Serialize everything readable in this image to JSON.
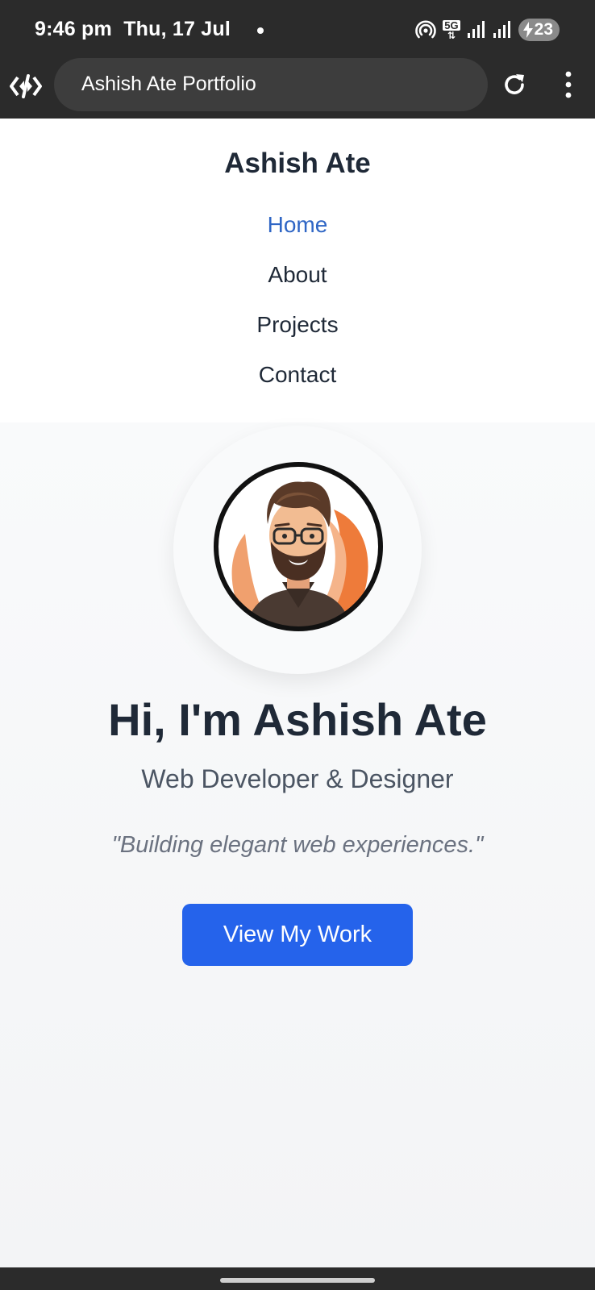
{
  "status_bar": {
    "time": "9:46 pm",
    "date": "Thu, 17 Jul",
    "network": "5G",
    "battery": "23",
    "icons": [
      "hotspot-icon",
      "5g-icon",
      "signal-icon",
      "signal-icon",
      "charging-icon"
    ]
  },
  "browser": {
    "url_title": "Ashish Ate Portfolio",
    "icons": [
      "devtools-icon",
      "reload-icon",
      "menu-icon"
    ]
  },
  "site": {
    "brand": "Ashish Ate",
    "nav": [
      {
        "label": "Home",
        "active": true
      },
      {
        "label": "About",
        "active": false
      },
      {
        "label": "Projects",
        "active": false
      },
      {
        "label": "Contact",
        "active": false
      }
    ],
    "active_color": "#2f66c5"
  },
  "hero": {
    "title": "Hi, I'm Ashish Ate",
    "subtitle": "Web Developer & Designer",
    "quote": "\"Building elegant web experiences.\"",
    "cta_label": "View My Work",
    "cta_color": "#2563eb"
  }
}
